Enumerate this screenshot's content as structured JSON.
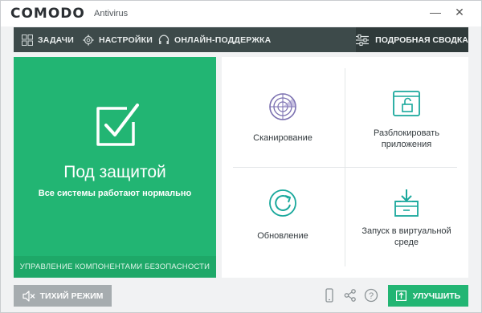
{
  "title_bar": {
    "brand": "COMODO",
    "product": "Antivirus",
    "minimize_glyph": "—",
    "close_glyph": "✕"
  },
  "nav": {
    "items": [
      {
        "label": "ЗАДАЧИ",
        "icon": "grid-icon"
      },
      {
        "label": "НАСТРОЙКИ",
        "icon": "gear-icon"
      },
      {
        "label": "ОНЛАЙН-ПОДДЕРЖКА",
        "icon": "support-icon"
      }
    ],
    "summary_label": "ПОДРОБНАЯ СВОДКА",
    "summary_icon": "sliders-icon"
  },
  "status": {
    "title": "Под защитой",
    "subtitle": "Все системы работают нормально",
    "footer": "УПРАВЛЕНИЕ КОМПОНЕНТАМИ БЕЗОПАСНОСТИ",
    "color": "#22b573"
  },
  "tiles": [
    {
      "label_lines": [
        "Сканирование"
      ],
      "icon": "radar-scan-icon"
    },
    {
      "label_lines": [
        "Разблокировать",
        "приложения"
      ],
      "icon": "unlock-window-icon"
    },
    {
      "label_lines": [
        "Обновление"
      ],
      "icon": "refresh-icon"
    },
    {
      "label_lines": [
        "Запуск в виртуальной",
        "среде"
      ],
      "icon": "sandbox-box-icon"
    }
  ],
  "footer": {
    "quiet_mode_label": "ТИХИЙ РЕЖИМ",
    "upgrade_label": "УЛУЧШИТЬ",
    "help_glyph": "?",
    "accent": "#22b573"
  }
}
